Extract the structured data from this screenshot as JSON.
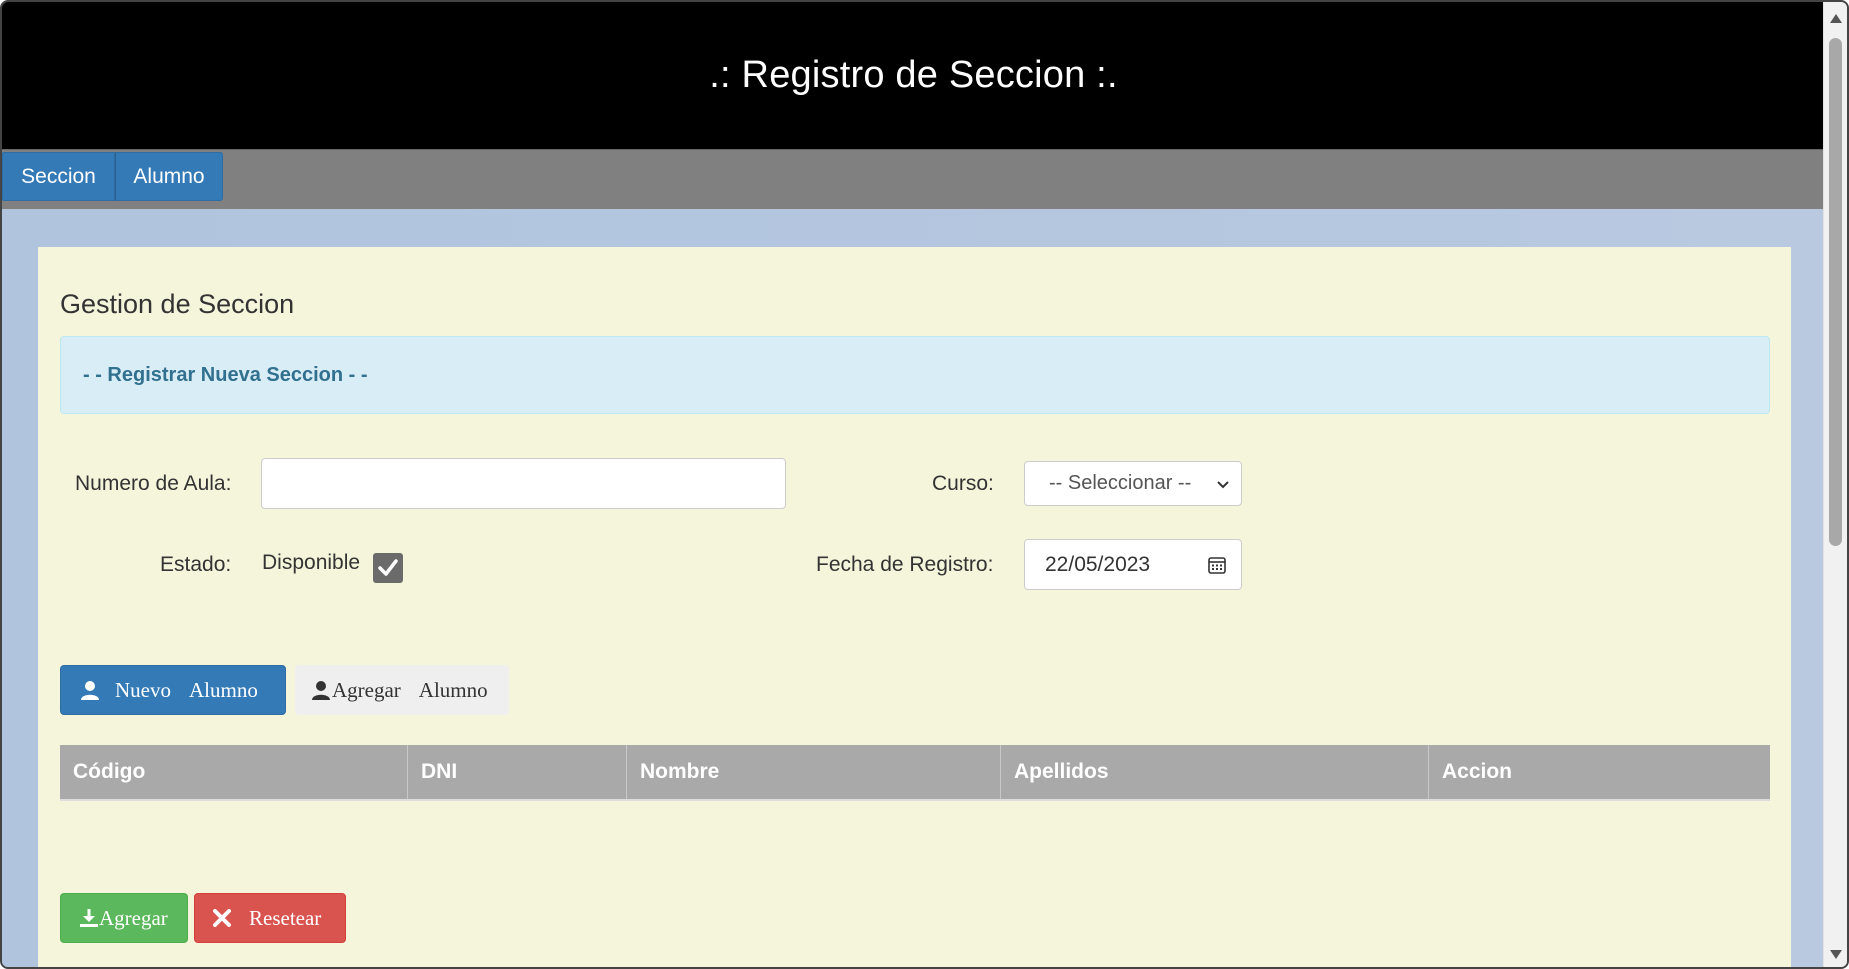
{
  "header": {
    "title": ".: Registro de Seccion :."
  },
  "nav": {
    "items": [
      {
        "label": "Seccion"
      },
      {
        "label": "Alumno"
      }
    ]
  },
  "panel": {
    "title": "Gestion de Seccion",
    "alert": "- - Registrar Nueva Seccion - -"
  },
  "form": {
    "numero_aula_label": "Numero de Aula:",
    "numero_aula_value": "",
    "curso_label": "Curso:",
    "curso_selected": "-- Seleccionar --",
    "estado_label": "Estado:",
    "estado_text": "Disponible",
    "estado_checked": true,
    "fecha_label": "Fecha de Registro:",
    "fecha_value": "22/05/2023"
  },
  "buttons": {
    "nuevo_alumno": [
      "Nuevo",
      "Alumno"
    ],
    "agregar_alumno": [
      "Agregar",
      "Alumno"
    ],
    "agregar": "Agregar",
    "resetear": "Resetear"
  },
  "table": {
    "headers": [
      "Código",
      "DNI",
      "Nombre",
      "Apellidos",
      "Accion"
    ],
    "rows": []
  },
  "colors": {
    "header_bg": "#000000",
    "nav_bg": "#808080",
    "primary": "#337ab7",
    "success": "#5cb85c",
    "danger": "#d9534f",
    "panel_bg": "#f5f5dc",
    "page_bg": "#b0c4de"
  }
}
